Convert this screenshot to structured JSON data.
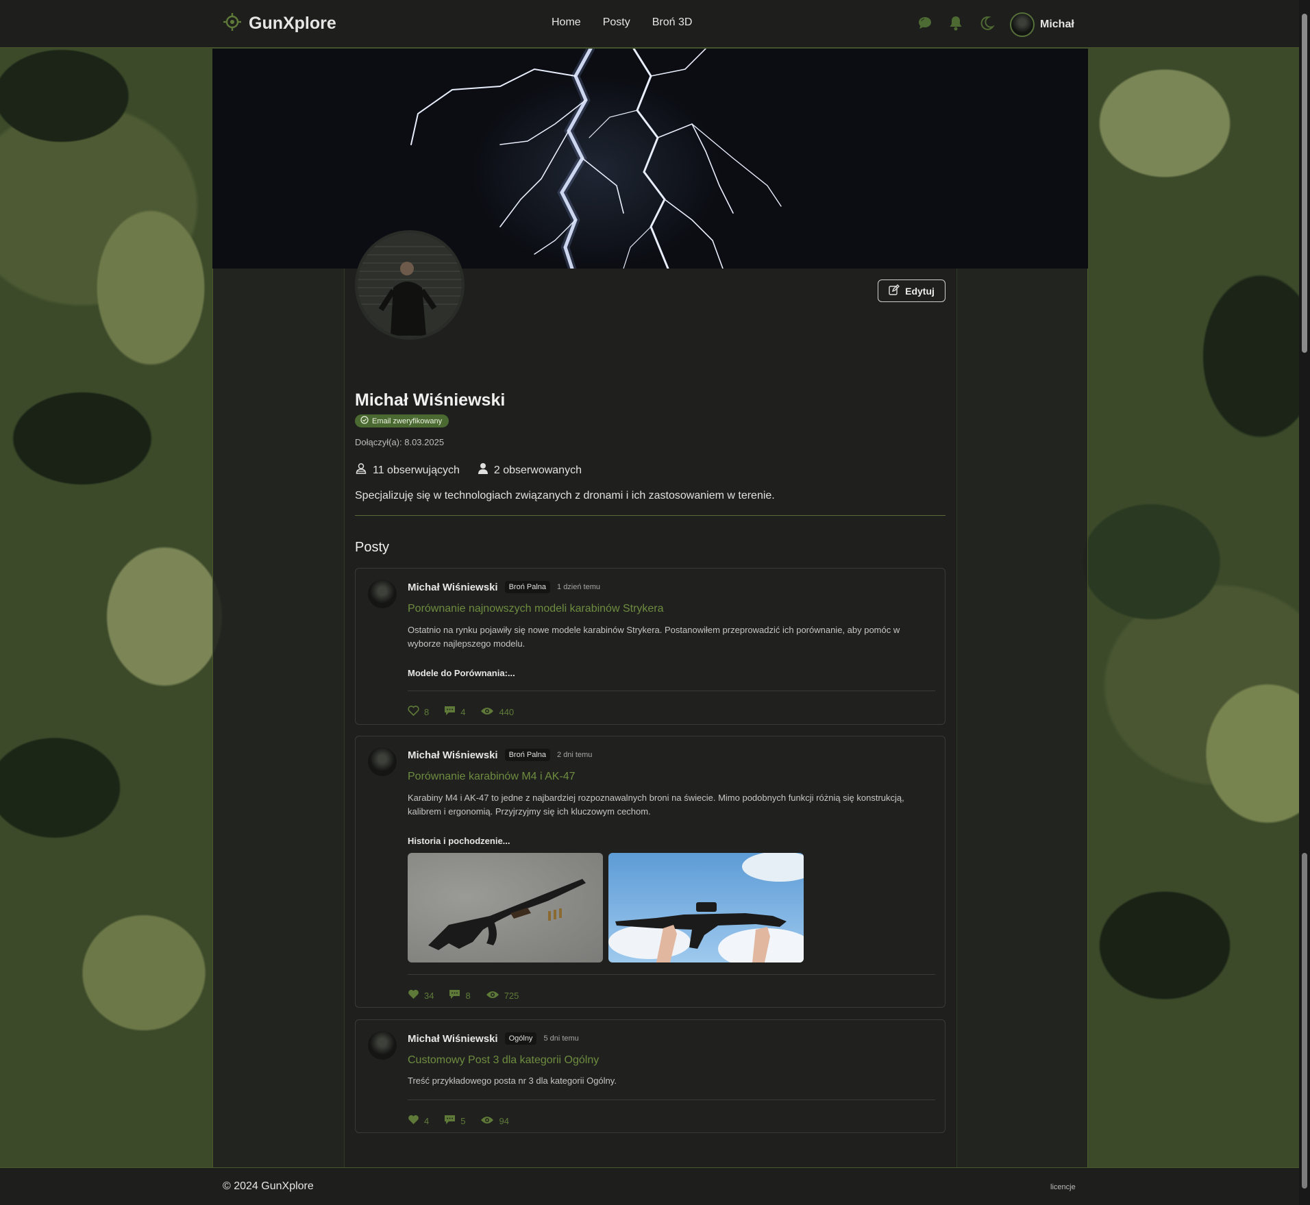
{
  "brand": {
    "name": "GunXplore"
  },
  "nav": {
    "home": "Home",
    "posts": "Posty",
    "gun3d": "Broń 3D"
  },
  "header": {
    "user_name": "Michał"
  },
  "profile": {
    "edit_label": "Edytuj",
    "name": "Michał Wiśniewski",
    "badge": "Email zweryfikowany",
    "joined": "Dołączył(a): 8.03.2025",
    "followers": "11 obserwujących",
    "following": "2 obserwowanych",
    "bio": "Specjalizuję się w technologiach związanych z dronami i ich zastosowaniem w terenie."
  },
  "posts_section": {
    "title": "Posty"
  },
  "posts": [
    {
      "author": "Michał Wiśniewski",
      "category": "Broń Palna",
      "time": "1 dzień temu",
      "title": "Porównanie najnowszych modeli karabinów Strykera",
      "text": "Ostatnio na rynku pojawiły się nowe modele karabinów Strykera. Postanowiłem przeprowadzić ich porównanie, aby pomóc w wyborze najlepszego modelu.",
      "subheading": "Modele do Porównania:...",
      "likes": "8",
      "comments": "4",
      "views": "440"
    },
    {
      "author": "Michał Wiśniewski",
      "category": "Broń Palna",
      "time": "2 dni temu",
      "title": "Porównanie karabinów M4 i AK-47",
      "text": "Karabiny M4 i AK-47 to jedne z najbardziej rozpoznawalnych broni na świecie. Mimo podobnych funkcji różnią się konstrukcją, kalibrem i ergonomią. Przyjrzyjmy się ich kluczowym cechom.",
      "subheading": "Historia i pochodzenie...",
      "likes": "34",
      "comments": "8",
      "views": "725"
    },
    {
      "author": "Michał Wiśniewski",
      "category": "Ogólny",
      "time": "5 dni temu",
      "title": "Customowy Post 3 dla kategorii Ogólny",
      "text": "Treść przykładowego posta nr 3 dla kategorii Ogólny.",
      "likes": "4",
      "comments": "5",
      "views": "94"
    }
  ],
  "footer": {
    "copyright": "© 2024 GunXplore",
    "licenses": "licencje"
  },
  "colors": {
    "accent": "#5f7a38",
    "link": "#6e8c3f",
    "badge": "#4b6a31",
    "surface": "#1f201e"
  }
}
